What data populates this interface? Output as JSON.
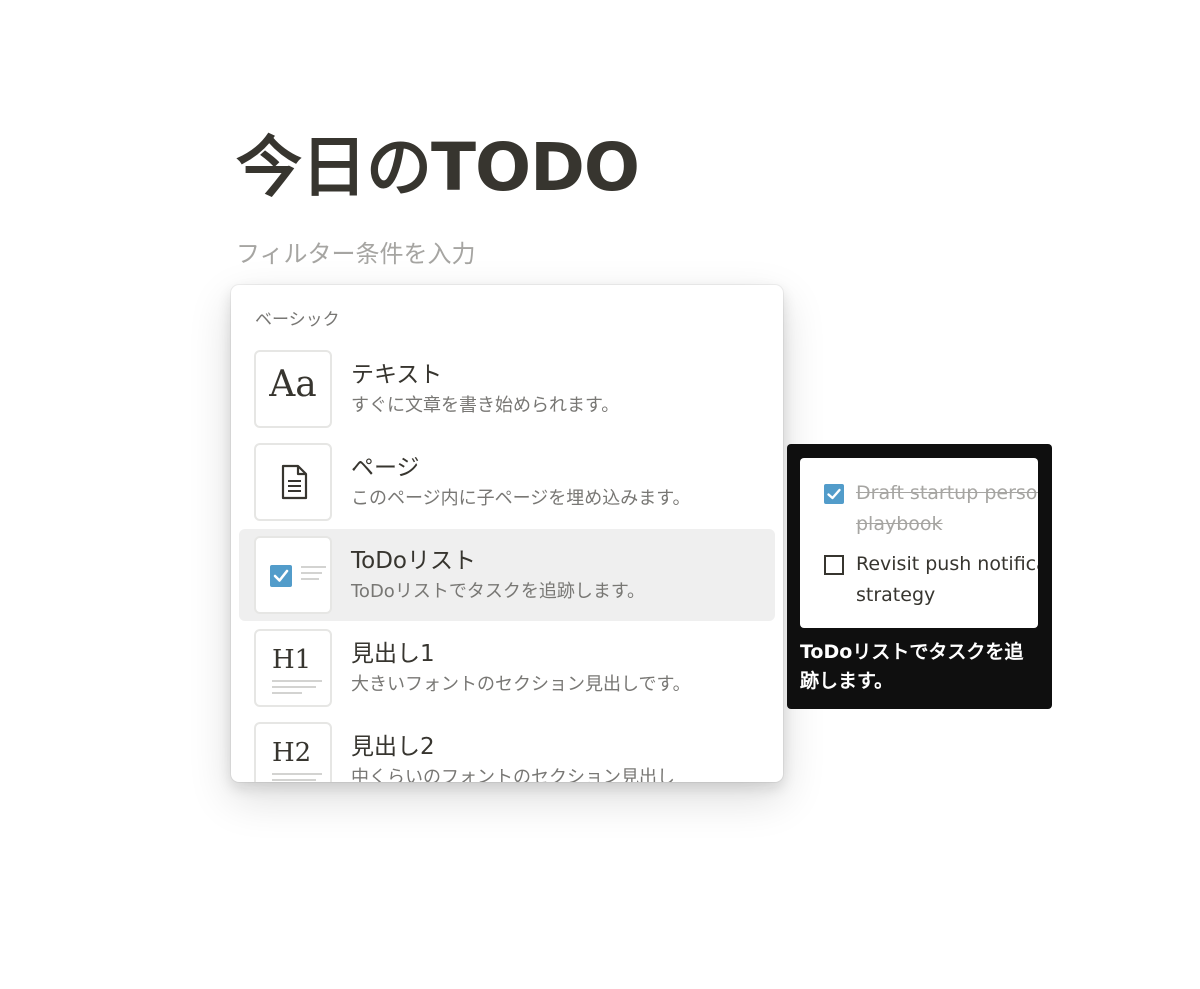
{
  "page": {
    "title": "今日のTODO",
    "filter_placeholder": "フィルター条件を入力"
  },
  "menu": {
    "section_label": "ベーシック",
    "items": [
      {
        "title": "テキスト",
        "description": "すぐに文章を書き始められます。",
        "icon": "text-aa-icon",
        "thumb_text": "Aa",
        "selected": false
      },
      {
        "title": "ページ",
        "description": "このページ内に子ページを埋め込みます。",
        "icon": "document-icon",
        "selected": false
      },
      {
        "title": "ToDoリスト",
        "description": "ToDoリストでタスクを追跡します。",
        "icon": "todo-checkbox-icon",
        "selected": true
      },
      {
        "title": "見出し1",
        "description": "大きいフォントのセクション見出しです。",
        "icon": "heading-1-icon",
        "thumb_text": "H1",
        "selected": false
      },
      {
        "title": "見出し2",
        "description": "中くらいのフォントのセクション見出し",
        "icon": "heading-2-icon",
        "thumb_text": "H2",
        "selected": false
      }
    ]
  },
  "preview": {
    "items": [
      {
        "text": "Draft startup persona interview playbook",
        "checked": true
      },
      {
        "text": "Revisit push notification strategy",
        "checked": false
      }
    ],
    "caption": "ToDoリストでタスクを追跡します。"
  },
  "colors": {
    "accent_blue": "#529cca",
    "text_primary": "#37352f",
    "text_secondary": "#787774",
    "selected_bg": "#efefef",
    "preview_bg": "#0f0f0f"
  }
}
